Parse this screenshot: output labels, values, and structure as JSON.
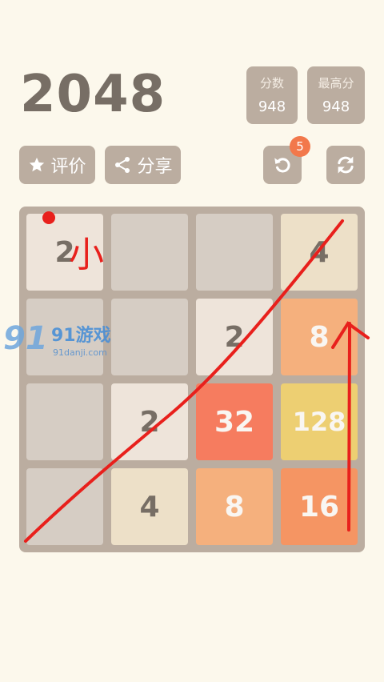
{
  "title": "2048",
  "score": {
    "label": "分数",
    "value": "948"
  },
  "best": {
    "label": "最高分",
    "value": "948"
  },
  "buttons": {
    "rate_label": "评价",
    "share_label": "分享",
    "undo_badge": "5"
  },
  "watermark": {
    "brand": "91游戏",
    "site": "91danji.com"
  },
  "annotation": {
    "handwritten_char": "小"
  },
  "board": {
    "rows": [
      [
        "2",
        "",
        "",
        "4"
      ],
      [
        "",
        "",
        "2",
        "8"
      ],
      [
        "",
        "2",
        "32",
        "128"
      ],
      [
        "",
        "4",
        "8",
        "16"
      ]
    ]
  },
  "colors": {
    "background": "#fcf8ec",
    "board": "#bbada0",
    "empty": "#d6cdc4",
    "tile_2": "#eee4da",
    "tile_4": "#ede0c8",
    "tile_8": "#f5b07d",
    "tile_16": "#f59563",
    "tile_32": "#f67c5f",
    "tile_128": "#edcf72",
    "dark_text": "#776e65",
    "light_text": "#f9f6f2",
    "annotation_red": "#e8201c"
  }
}
